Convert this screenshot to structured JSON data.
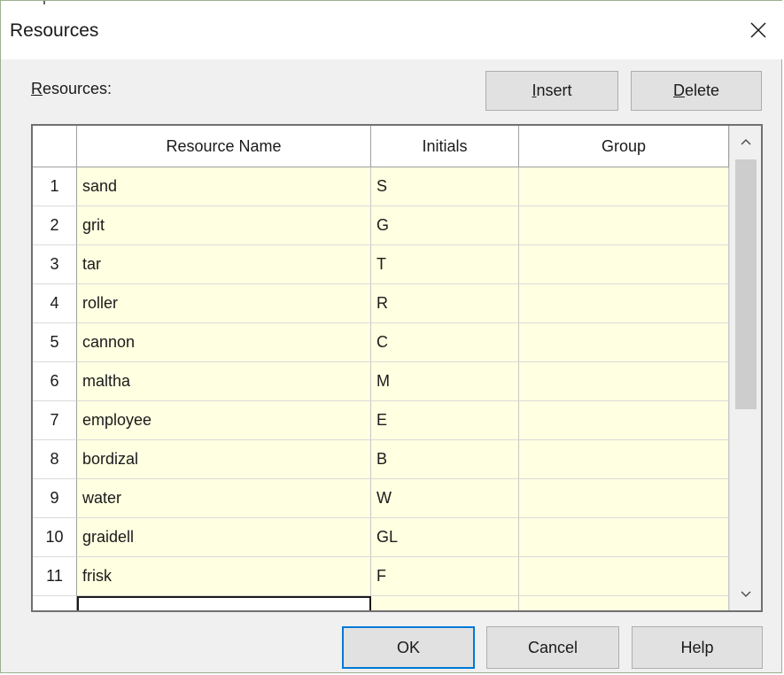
{
  "window": {
    "title": "Resources",
    "close_icon": "close-icon"
  },
  "resources_label": {
    "prefix": "R",
    "rest": "esources:"
  },
  "buttons": {
    "insert": {
      "u": "I",
      "rest": "nsert"
    },
    "delete": {
      "u": "D",
      "rest": "elete"
    },
    "ok": "OK",
    "cancel": "Cancel",
    "help": "Help"
  },
  "table": {
    "columns": [
      "Resource Name",
      "Initials",
      "Group"
    ],
    "rows": [
      {
        "num": "1",
        "name": "sand",
        "initials": "S",
        "group": ""
      },
      {
        "num": "2",
        "name": "grit",
        "initials": "G",
        "group": ""
      },
      {
        "num": "3",
        "name": "tar",
        "initials": "T",
        "group": ""
      },
      {
        "num": "4",
        "name": "roller",
        "initials": "R",
        "group": ""
      },
      {
        "num": "5",
        "name": "cannon",
        "initials": "C",
        "group": ""
      },
      {
        "num": "6",
        "name": "maltha",
        "initials": "M",
        "group": ""
      },
      {
        "num": "7",
        "name": "employee",
        "initials": "E",
        "group": ""
      },
      {
        "num": "8",
        "name": "bordizal",
        "initials": "B",
        "group": ""
      },
      {
        "num": "9",
        "name": "water",
        "initials": "W",
        "group": ""
      },
      {
        "num": "10",
        "name": "graidell",
        "initials": "GL",
        "group": ""
      },
      {
        "num": "11",
        "name": "frisk",
        "initials": "F",
        "group": ""
      }
    ]
  },
  "colors": {
    "cell_background": "#ffffe1",
    "default_button_border": "#0078d7"
  }
}
